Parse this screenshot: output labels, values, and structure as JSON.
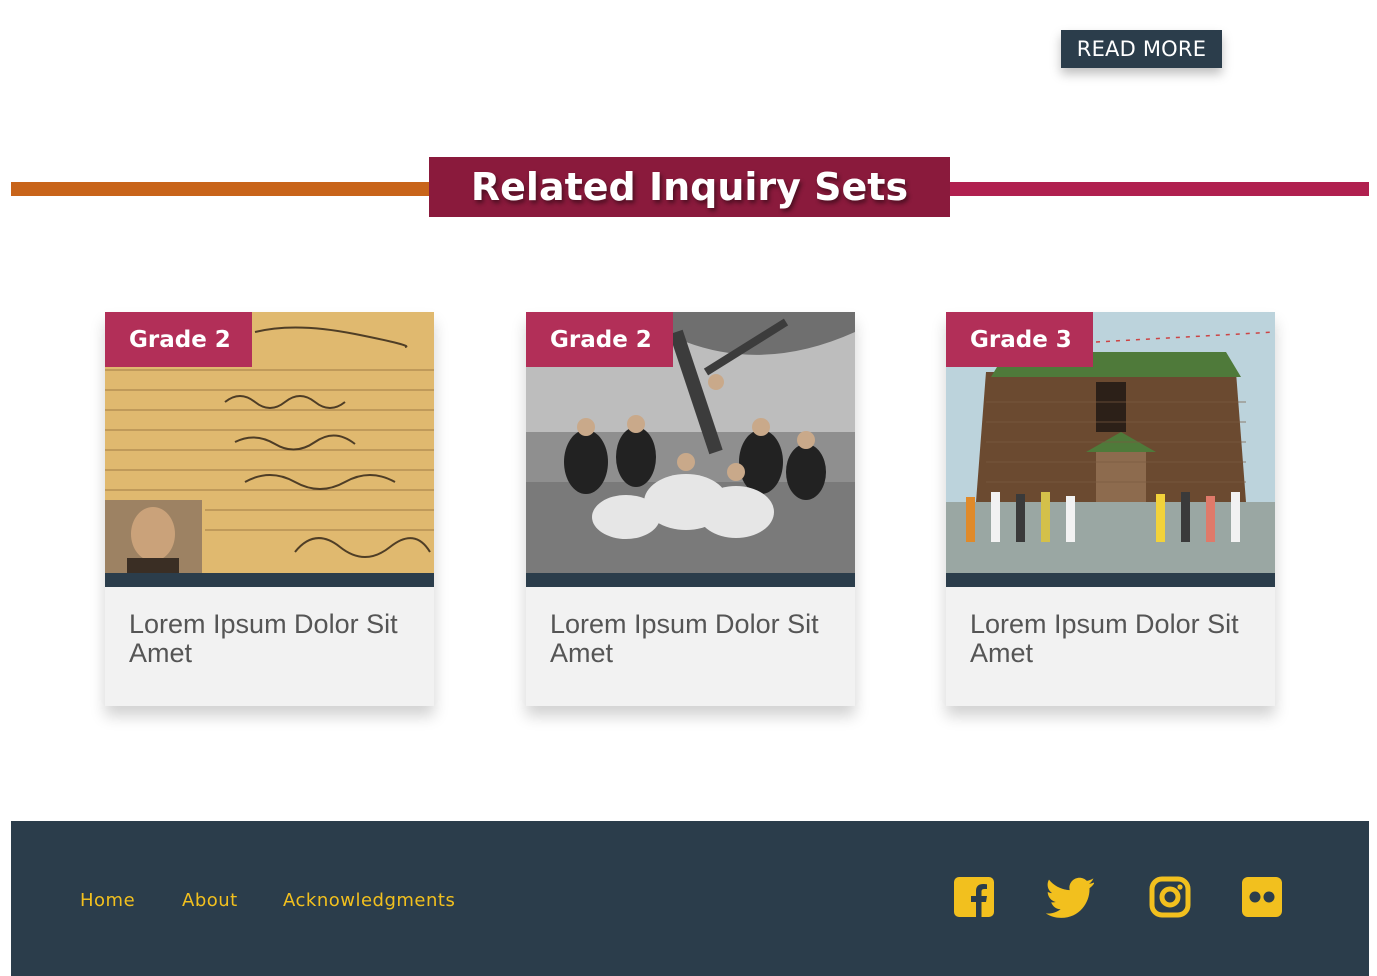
{
  "header": {
    "read_more_label": "READ MORE"
  },
  "section": {
    "title": "Related Inquiry Sets"
  },
  "cards": [
    {
      "grade": "Grade 2",
      "title": "Lorem Ipsum Dolor Sit Amet",
      "image": "certificate-of-residence-photo"
    },
    {
      "grade": "Grade 2",
      "title": "Lorem Ipsum Dolor Sit Amet",
      "image": "group-picnic-photo"
    },
    {
      "grade": "Grade 3",
      "title": "Lorem Ipsum Dolor Sit Amet",
      "image": "amusement-building-postcard"
    }
  ],
  "footer": {
    "nav": [
      "Home",
      "About",
      "Acknowledgments"
    ],
    "social": [
      "facebook-icon",
      "twitter-icon",
      "instagram-icon",
      "flickr-icon"
    ]
  },
  "colors": {
    "navy": "#2b3d4b",
    "orange": "#c8641a",
    "crimson": "#b0204f",
    "title_bg": "#8a1a3c",
    "badge": "#b22f58",
    "footer_link": "#f2c01e"
  }
}
